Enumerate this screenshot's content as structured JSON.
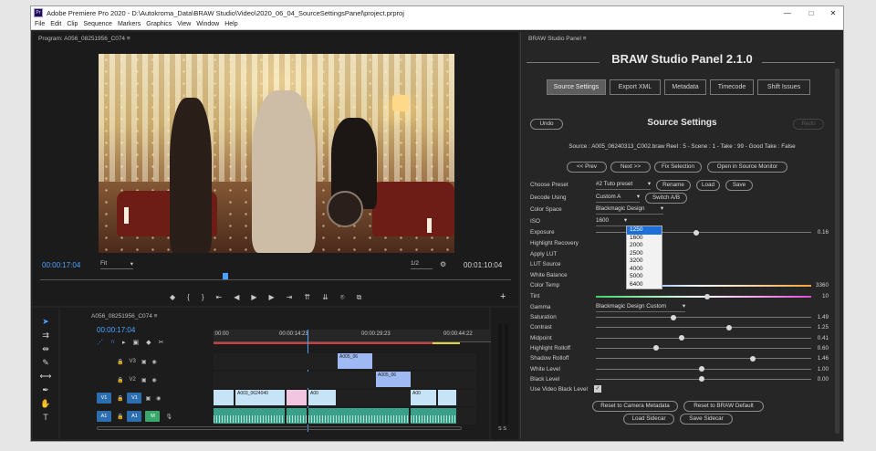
{
  "window": {
    "title": "Adobe Premiere Pro 2020 - D:\\Autokroma_Data\\BRAW Studio\\Video\\2020_06_04_SourceSettingsPanel\\project.prproj",
    "app_icon": "Pr",
    "minimize": "—",
    "maximize": "□",
    "close": "✕"
  },
  "menu": [
    "File",
    "Edit",
    "Clip",
    "Sequence",
    "Markers",
    "Graphics",
    "View",
    "Window",
    "Help"
  ],
  "program": {
    "tab": "Program: A056_08251956_C074  ≡",
    "timecode": "00:00:17:04",
    "fit": "Fit",
    "fraction": "1/2",
    "duration": "00:01:10:04"
  },
  "timeline": {
    "tab": "A056_08251956_C074  ≡",
    "timecode": "00:00:17:04",
    "ruler": [
      ":00:00",
      "00:00:14:23",
      "00:00:29:23",
      "00:00:44:22"
    ],
    "tracks": [
      {
        "name": "V3"
      },
      {
        "name": "V2"
      },
      {
        "name": "V1"
      },
      {
        "name": "A1",
        "mute": "M"
      }
    ],
    "clips": {
      "v3": "A005_06",
      "v2": "A005_06",
      "v1a": "A003_0624040",
      "v1b": "A00",
      "v1c": "A00"
    },
    "meter_scale": "S  S"
  },
  "braw": {
    "panel_tab": "BRAW Studio Panel  ≡",
    "title": "BRAW Studio Panel 2.1.0",
    "tabs": [
      "Source Settings",
      "Export XML",
      "Metadata",
      "Timecode",
      "Shift Issues"
    ],
    "undo": "Undo",
    "section_title": "Source Settings",
    "redo": "Redo",
    "source_line": "Source : A005_06240313_C002.braw  Reel : 5 - Scene : 1 - Take : 99 - Good Take : False",
    "nav_buttons": [
      "<< Prev",
      "Next >>",
      "Fix Selection",
      "Open in Source Monitor"
    ],
    "choose_preset_label": "Choose Preset",
    "preset_value": "#2 Tuto preset",
    "preset_buttons": [
      "Rename",
      "Load",
      "Save"
    ],
    "decode_label": "Decode Using",
    "decode_value": "Custom A",
    "switch_ab": "Switch A/B",
    "color_space_label": "Color Space",
    "color_space_value": "Blackmagic Design",
    "iso_label": "ISO",
    "iso_value": "1600",
    "iso_options": [
      "1250",
      "1600",
      "2000",
      "2500",
      "3200",
      "4000",
      "5000",
      "6400"
    ],
    "params": [
      {
        "label": "Exposure",
        "value": "0.16",
        "pos": 0.44
      },
      {
        "label": "Highlight Recovery",
        "value": ""
      },
      {
        "label": "Apply LUT",
        "value": ""
      },
      {
        "label": "LUT Source",
        "value": ""
      },
      {
        "label": "White Balance",
        "value": ""
      },
      {
        "label": "Color Temp",
        "value": "3360"
      },
      {
        "label": "Tint",
        "value": "10",
        "pos": 0.5
      }
    ],
    "gamma_label": "Gamma",
    "gamma_value": "Blackmagic Design Custom",
    "gamma_params": [
      {
        "label": "Saturation",
        "value": "1.49",
        "pos": 0.36
      },
      {
        "label": "Contrast",
        "value": "1.25",
        "pos": 0.62
      },
      {
        "label": "Midpoint",
        "value": "0.41",
        "pos": 0.4
      },
      {
        "label": "Highlight Rolloff",
        "value": "0.60",
        "pos": 0.28
      },
      {
        "label": "Shadow Rolloff",
        "value": "1.46",
        "pos": 0.73
      },
      {
        "label": "White Level",
        "value": "1.00",
        "pos": 0.49
      },
      {
        "label": "Black Level",
        "value": "0.00",
        "pos": 0.49
      }
    ],
    "video_black_label": "Use Video Black Level",
    "video_black_checked": "✓",
    "bottom_buttons": [
      "Reset to Camera Metadata",
      "Reset to BRAW Default"
    ],
    "sidecar_buttons": [
      "Load Sidecar",
      "Save Sidecar"
    ]
  },
  "icons": {
    "marker": "◆",
    "in": "{",
    "out": "}",
    "step_back": "⇤",
    "back": "◀",
    "play": "▶",
    "fwd": "▶",
    "step_fwd": "⇥",
    "lift": "⇈",
    "extract": "⇊",
    "camera": "⌾",
    "export": "⧉",
    "add": "+",
    "settings_wrench": "🔧",
    "dropdown": "▾"
  }
}
